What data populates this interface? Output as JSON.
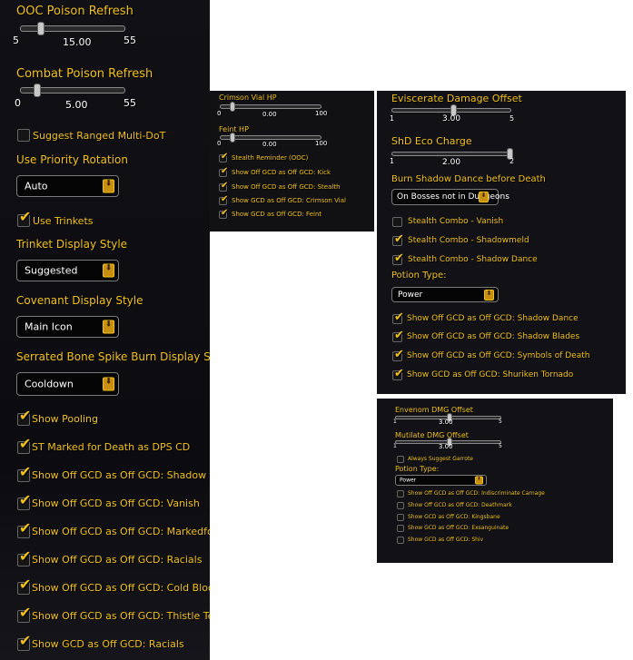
{
  "panel_main": {
    "ooc_poison": {
      "label": "OOC Poison Refresh",
      "min": "5",
      "max": "55",
      "value": "15.00",
      "fraction": 0.2
    },
    "combat_poison": {
      "label": "Combat Poison Refresh",
      "min": "0",
      "max": "55",
      "value": "5.00",
      "fraction": 0.09
    },
    "suggest_ranged": {
      "label": "Suggest Ranged Multi-DoT",
      "checked": false
    },
    "priority_rotation": {
      "label": "Use Priority Rotation",
      "selected": "Auto"
    },
    "use_trinkets": {
      "label": "Use Trinkets",
      "checked": true
    },
    "trinket_display": {
      "label": "Trinket Display Style",
      "selected": "Suggested"
    },
    "covenant_display": {
      "label": "Covenant Display Style",
      "selected": "Main Icon"
    },
    "serrated_display": {
      "label": "Serrated Bone Spike Burn Display Style",
      "selected": "Cooldown"
    },
    "checks": [
      {
        "label": "Show Pooling",
        "checked": true
      },
      {
        "label": "ST Marked for Death as DPS CD",
        "checked": true
      },
      {
        "label": "Show Off GCD as Off GCD: Shadow Dance",
        "checked": true
      },
      {
        "label": "Show Off GCD as Off GCD: Vanish",
        "checked": true
      },
      {
        "label": "Show Off GCD as Off GCD: Markedfor Death",
        "checked": true
      },
      {
        "label": "Show Off GCD as Off GCD: Racials",
        "checked": true
      },
      {
        "label": "Show Off GCD as Off GCD: Cold Blood",
        "checked": true
      },
      {
        "label": "Show Off GCD as Off GCD: Thistle Tea",
        "checked": true
      },
      {
        "label": "Show GCD as Off GCD: Racials",
        "checked": true
      }
    ]
  },
  "panel_outlaw": {
    "crimson_vial": {
      "label": "Crimson Vial HP",
      "min": "0",
      "max": "100",
      "value": "0.00",
      "fraction": 0.05
    },
    "feint": {
      "label": "Feint HP",
      "min": "0",
      "max": "100",
      "value": "0.00",
      "fraction": 0.05
    },
    "checks": [
      {
        "label": "Stealth Reminder (OOC)",
        "checked": true
      },
      {
        "label": "Show Off GCD as Off GCD: Kick",
        "checked": true
      },
      {
        "label": "Show Off GCD as Off GCD: Stealth",
        "checked": true
      },
      {
        "label": "Show GCD as Off GCD: Crimson Vial",
        "checked": true
      },
      {
        "label": "Show GCD as Off GCD: Feint",
        "checked": true
      }
    ]
  },
  "panel_subtlety": {
    "eviscerate": {
      "label": "Eviscerate Damage Offset",
      "min": "1",
      "max": "5",
      "value": "3.00",
      "fraction": 0.5
    },
    "shd_eco": {
      "label": "ShD Eco Charge",
      "min": "1",
      "max": "2",
      "value": "2.00",
      "fraction": 1.0
    },
    "burn_sd": {
      "label": "Burn Shadow Dance before Death",
      "selected": "On Bosses not in Dungeons"
    },
    "checks": [
      {
        "label": "Stealth Combo - Vanish",
        "checked": false
      },
      {
        "label": "Stealth Combo - Shadowmeld",
        "checked": true
      },
      {
        "label": "Stealth Combo - Shadow Dance",
        "checked": true
      }
    ],
    "potion": {
      "label": "Potion Type:",
      "selected": "Power"
    },
    "checks2": [
      {
        "label": "Show Off GCD as Off GCD: Shadow Dance",
        "checked": true
      },
      {
        "label": "Show Off GCD as Off GCD: Shadow Blades",
        "checked": true
      },
      {
        "label": "Show Off GCD as Off GCD: Symbols of Death",
        "checked": true
      },
      {
        "label": "Show GCD as Off GCD: Shuriken Tornado",
        "checked": true
      }
    ]
  },
  "panel_assassination": {
    "envenom": {
      "label": "Envenom DMG Offset",
      "min": "1",
      "max": "5",
      "value": "3.00",
      "fraction": 0.5
    },
    "mutilate": {
      "label": "Mutilate DMG Offset",
      "min": "1",
      "max": "5",
      "value": "3.00",
      "fraction": 0.5
    },
    "garrote": {
      "label": "Always Suggest Garrote",
      "checked": false
    },
    "potion": {
      "label": "Potion Type:",
      "selected": "Power"
    },
    "checks": [
      {
        "label": "Show Off GCD as Off GCD: Indiscriminate Carnage",
        "checked": false
      },
      {
        "label": "Show Off GCD as Off GCD: Deathmark",
        "checked": false
      },
      {
        "label": "Show GCD as Off GCD: Kingsbane",
        "checked": false
      },
      {
        "label": "Show GCD as Off GCD: Exsanguinate",
        "checked": false
      },
      {
        "label": "Show GCD as Off GCD: Shiv",
        "checked": false
      }
    ]
  },
  "icons": {
    "check": "✔",
    "dropdown": "⬇"
  }
}
